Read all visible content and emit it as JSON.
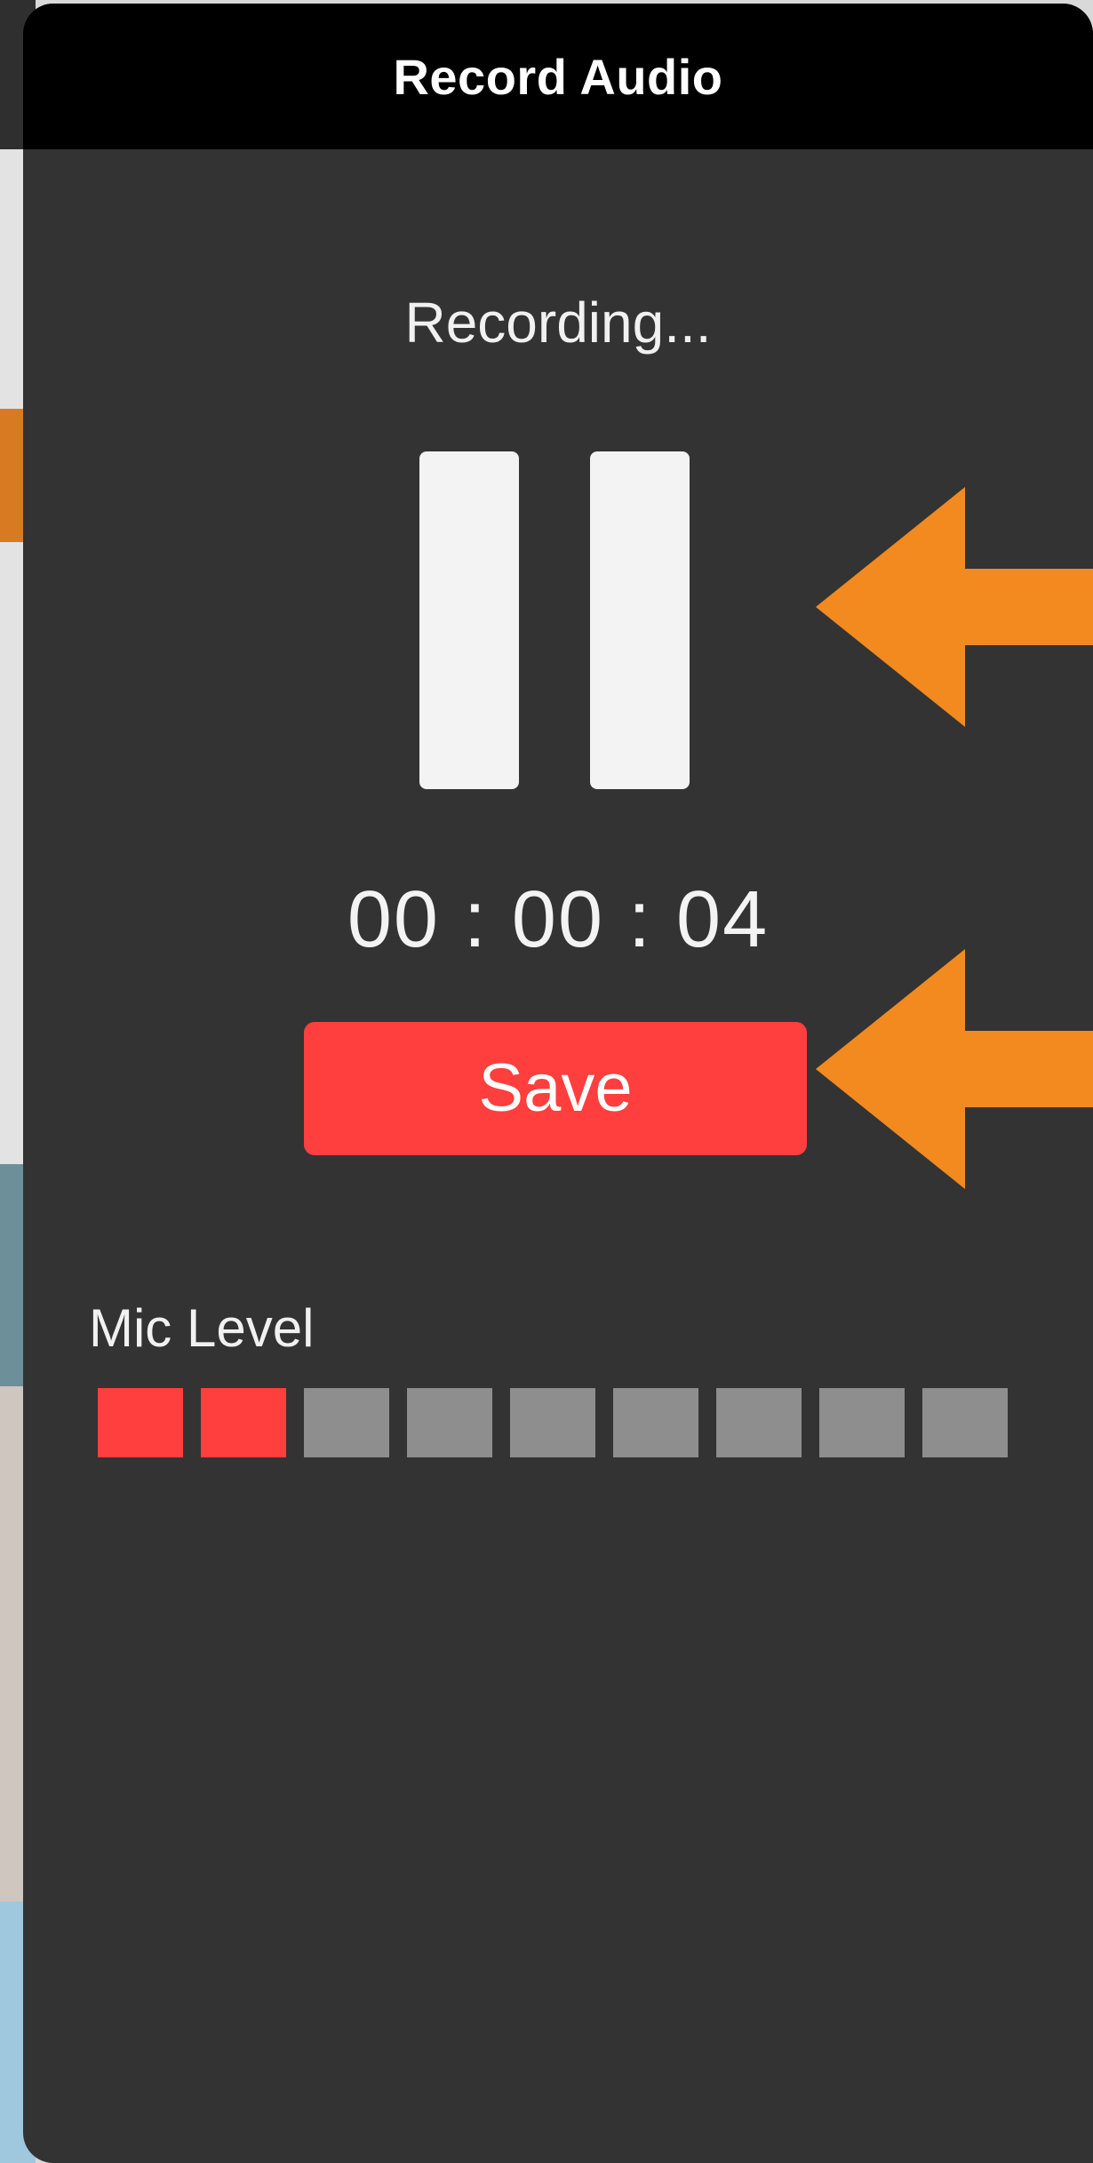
{
  "modal": {
    "title": "Record Audio",
    "status": "Recording...",
    "timer": "00 : 00 : 04",
    "save_label": "Save",
    "mic_label": "Mic Level",
    "mic_level": {
      "active": 2,
      "total": 9
    }
  },
  "icons": {
    "pause": "pause-icon",
    "annotation_arrow": "left-arrow-icon"
  },
  "colors": {
    "accent_red": "#ff3f3d",
    "meter_inactive": "#8e8e8e",
    "annotation_orange": "#f28a1f",
    "modal_bg": "#333333",
    "header_bg": "#000000"
  }
}
